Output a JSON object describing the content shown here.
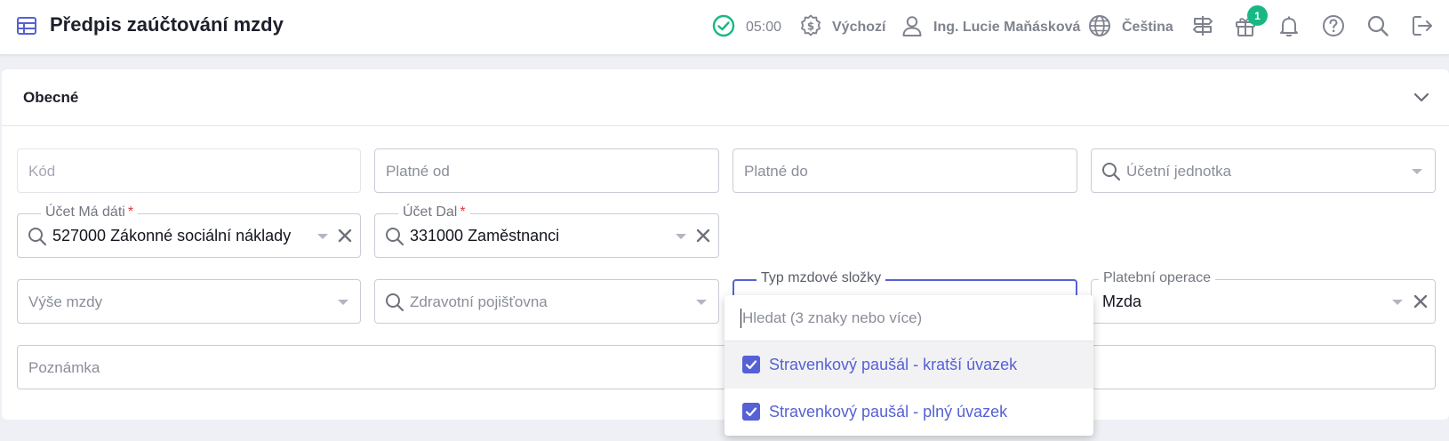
{
  "header": {
    "title": "Předpis zaúčtování mzdy",
    "timer": "05:00",
    "currency_label": "Výchozí",
    "user_name": "Ing. Lucie Maňásková",
    "language": "Čeština",
    "gift_badge": "1",
    "accent_color": "#5561d6",
    "success_color": "#18b884"
  },
  "section": {
    "title": "Obecné"
  },
  "fields": {
    "kod": {
      "placeholder": "Kód"
    },
    "platne_od": {
      "placeholder": "Platné od"
    },
    "platne_do": {
      "placeholder": "Platné do"
    },
    "ucetni_jednotka": {
      "placeholder": "Účetní jednotka"
    },
    "ucet_ma_dati": {
      "label": "Účet Má dáti",
      "value": "527000 Zákonné sociální náklady",
      "required_mark": "*"
    },
    "ucet_dal": {
      "label": "Účet Dal",
      "value": "331000 Zaměstnanci",
      "required_mark": "*"
    },
    "vyse_mzdy": {
      "placeholder": "Výše mzdy"
    },
    "zdravotni_pojistovna": {
      "placeholder": "Zdravotní pojišťovna"
    },
    "typ_mzdove_slozky": {
      "label": "Typ mzdové složky"
    },
    "platebni_operace": {
      "label": "Platební operace",
      "value": "Mzda"
    },
    "poznamka": {
      "placeholder": "Poznámka"
    }
  },
  "dropdown": {
    "search_placeholder": "Hledat (3 znaky nebo více)",
    "options": [
      {
        "label": "Stravenkový paušál - kratší úvazek",
        "checked": true
      },
      {
        "label": "Stravenkový paušál - plný úvazek",
        "checked": true
      }
    ]
  }
}
